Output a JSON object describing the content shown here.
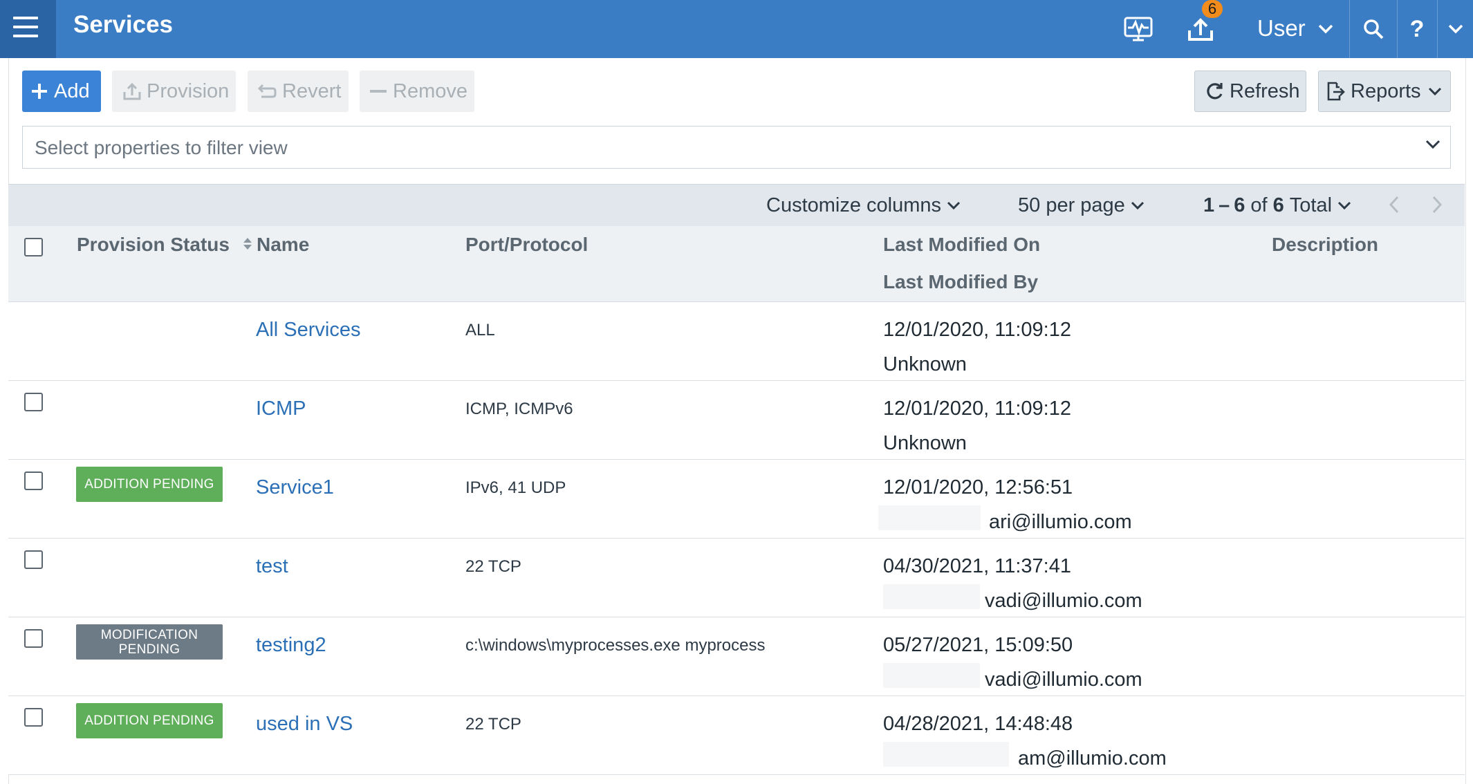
{
  "header": {
    "title": "Services",
    "notification_count": "6",
    "user_label": "User",
    "help_label": "?"
  },
  "toolbar": {
    "add_label": "Add",
    "provision_label": "Provision",
    "revert_label": "Revert",
    "remove_label": "Remove",
    "refresh_label": "Refresh",
    "reports_label": "Reports"
  },
  "filter": {
    "placeholder": "Select properties to filter view"
  },
  "table_controls": {
    "customize_label": "Customize columns",
    "per_page_label": "50 per page",
    "range_start": "1",
    "range_dash": "–",
    "range_end": "6",
    "range_of": "of",
    "range_total_count": "6",
    "range_total_word": "Total"
  },
  "columns": {
    "provision_status": "Provision Status",
    "name": "Name",
    "port_protocol": "Port/Protocol",
    "last_modified_on": "Last Modified On",
    "last_modified_by": "Last Modified By",
    "description": "Description"
  },
  "rows": [
    {
      "status": "",
      "name": "All Services",
      "port": "ALL",
      "modified_on": "12/01/2020, 11:09:12",
      "modified_by": "Unknown",
      "description": ""
    },
    {
      "status": "",
      "name": "ICMP",
      "port": "ICMP, ICMPv6",
      "modified_on": "12/01/2020, 11:09:12",
      "modified_by": "Unknown",
      "description": ""
    },
    {
      "status": "ADDITION PENDING",
      "name": "Service1",
      "port": "IPv6, 41 UDP",
      "modified_on": "12/01/2020, 12:56:51",
      "modified_by": "ari@illumio.com",
      "description": ""
    },
    {
      "status": "",
      "name": "test",
      "port": "22 TCP",
      "modified_on": "04/30/2021, 11:37:41",
      "modified_by": "vadi@illumio.com",
      "description": ""
    },
    {
      "status": "MODIFICATION PENDING",
      "name": "testing2",
      "port": "c:\\windows\\myprocesses.exe myprocess",
      "modified_on": "05/27/2021, 15:09:50",
      "modified_by": "vadi@illumio.com",
      "description": ""
    },
    {
      "status": "ADDITION PENDING",
      "name": "used in VS",
      "port": "22 TCP",
      "modified_on": "04/28/2021, 14:48:48",
      "modified_by": "am@illumio.com",
      "description": ""
    }
  ],
  "colors": {
    "header_bg": "#3a7dc5",
    "accent": "#3a83d6",
    "addition_pending": "#5fae5a",
    "modification_pending": "#6d7b87",
    "link": "#2b6fb6",
    "badge": "#f28c1c"
  }
}
